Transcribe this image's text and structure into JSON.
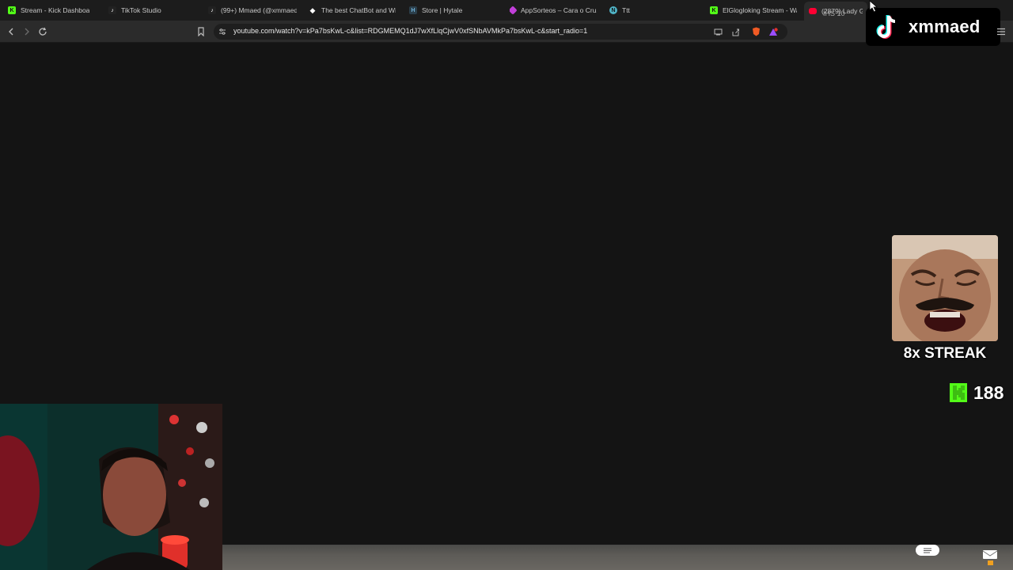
{
  "browser": {
    "tabs": [
      {
        "label": "Stream - Kick Dashboa",
        "favicon": "kick-icon",
        "color": "#53fc18"
      },
      {
        "label": "TikTok Studio",
        "favicon": "tiktok-icon",
        "color": "#ffffff"
      },
      {
        "label": "(99+) Mmaed (@xmmaed)",
        "favicon": "tiktok-icon",
        "color": "#ffffff"
      },
      {
        "label": "The best ChatBot and Wid",
        "favicon": "streamelements-icon",
        "color": "#ffffff"
      },
      {
        "label": "Store | Hytale",
        "favicon": "hytale-icon",
        "color": "#6fb1d8"
      },
      {
        "label": "AppSorteos – Cara o Cruz",
        "favicon": "appsorteos-icon",
        "color": "#c13fd9"
      },
      {
        "label": "Ttt",
        "favicon": "n-icon",
        "color": "#4fb3c6"
      },
      {
        "label": "ElGlogloking Stream - Wa",
        "favicon": "kick-icon",
        "color": "#53fc18"
      },
      {
        "label": "(2879) Lady Gag",
        "favicon": "youtube-icon",
        "color": "#ff0033"
      }
    ],
    "url": "youtube.com/watch?v=kPa7bsKwL-c&list=RDGMEMQ1dJ7wXfLlqCjwV0xfSNbAVMkPa7bsKwL-c&start_radio=1",
    "clock_fragment": "IHS 10"
  },
  "overlay": {
    "tiktok_handle": "xmmaed",
    "streak_text": "8x STREAK",
    "kick_count": "188"
  },
  "colors": {
    "kick_green": "#53fc18",
    "background": "#141414",
    "toolbar": "#2b2b2b"
  }
}
